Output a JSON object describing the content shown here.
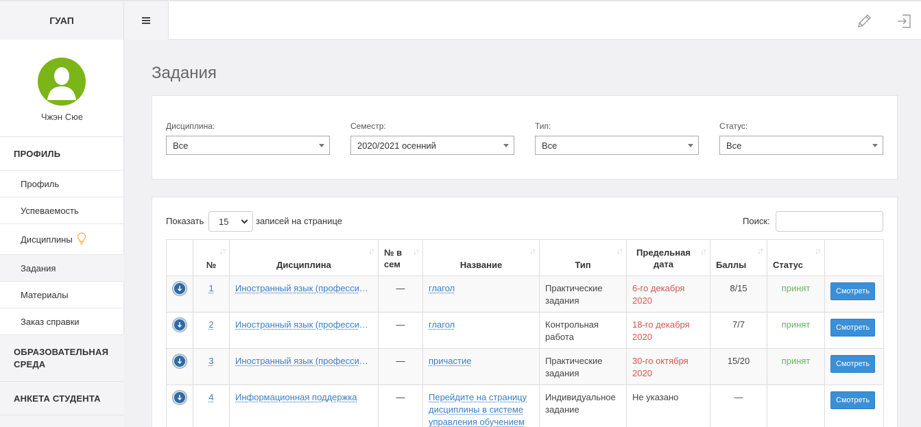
{
  "header": {
    "brand": "ГУАП"
  },
  "sidebar": {
    "user_name": "Чжэн Сюе",
    "sections": [
      {
        "label": "ПРОФИЛЬ"
      },
      {
        "label": "ОБРАЗОВАТЕЛЬНАЯ СРЕДА"
      },
      {
        "label": "АНКЕТА СТУДЕНТА"
      }
    ],
    "items": [
      {
        "label": "Профиль"
      },
      {
        "label": "Успеваемость"
      },
      {
        "label": "Дисциплины"
      },
      {
        "label": "Задания"
      },
      {
        "label": "Материалы"
      },
      {
        "label": "Заказ справки"
      }
    ]
  },
  "main": {
    "title": "Задания",
    "filters": [
      {
        "label": "Дисциплина:",
        "value": "Все"
      },
      {
        "label": "Семестр:",
        "value": "2020/2021 осенний"
      },
      {
        "label": "Тип:",
        "value": "Все"
      },
      {
        "label": "Статус:",
        "value": "Все"
      }
    ],
    "table_controls": {
      "show_label": "Показать",
      "page_size": "15",
      "records_label": "записей на странице",
      "search_label": "Поиск:"
    },
    "columns": [
      "№",
      "Дисциплина",
      "№ в сем",
      "Название",
      "Тип",
      "Предельная дата",
      "Баллы",
      "Статус"
    ],
    "rows": [
      {
        "num": "1",
        "discipline": "Иностранный язык (профессиональный)",
        "sem_no": "—",
        "name": "глагол",
        "type": "Практические задания",
        "deadline": "6-го декабря 2020",
        "score": "8/15",
        "status": "принят",
        "action": "Смотреть"
      },
      {
        "num": "2",
        "discipline": "Иностранный язык (профессиональный)",
        "sem_no": "—",
        "name": "глагол",
        "type": "Контрольная работа",
        "deadline": "18-го декабря 2020",
        "score": "7/7",
        "status": "принят",
        "action": "Смотреть"
      },
      {
        "num": "3",
        "discipline": "Иностранный язык (профессиональный)",
        "sem_no": "—",
        "name": "причастие",
        "type": "Практические задания",
        "deadline": "30-го октября 2020",
        "score": "15/20",
        "status": "принят",
        "action": "Смотреть"
      },
      {
        "num": "4",
        "discipline": "Информационная поддержка",
        "sem_no": "—",
        "name": "Перейдите на страницу дисциплины в системе управления обучением",
        "type": "Индивидуальное задание",
        "deadline": "Не указано",
        "score": "—",
        "status": "",
        "action": "Смотреть"
      }
    ]
  },
  "colors": {
    "accent": "#3a8fd9",
    "link": "#3a7dc7",
    "deadline": "#d9534f",
    "status_ok": "#5cb85c",
    "avatar": "#7cb518"
  },
  "icons": [
    "menu-icon",
    "pencil-icon",
    "logout-icon",
    "lightbulb-icon",
    "download-icon",
    "sort-icon"
  ]
}
